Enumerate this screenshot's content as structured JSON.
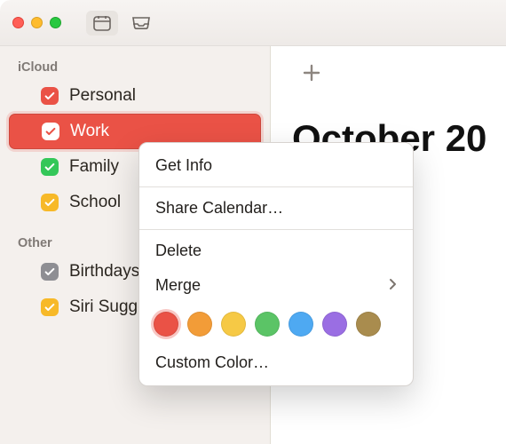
{
  "sidebar": {
    "sections": [
      {
        "title": "iCloud",
        "items": [
          {
            "label": "Personal",
            "color": "#ea5246",
            "selected": false
          },
          {
            "label": "Work",
            "color": "#ea5246",
            "selected": true
          },
          {
            "label": "Family",
            "color": "#34c759",
            "selected": false
          },
          {
            "label": "School",
            "color": "#f7b928",
            "selected": false
          }
        ]
      },
      {
        "title": "Other",
        "items": [
          {
            "label": "Birthdays",
            "color": "#8e8e93",
            "selected": false
          },
          {
            "label": "Siri Suggestions",
            "color": "#f7b928",
            "selected": false
          }
        ]
      }
    ]
  },
  "main": {
    "month_title": "October 20"
  },
  "context_menu": {
    "get_info": "Get Info",
    "share": "Share Calendar…",
    "delete": "Delete",
    "merge": "Merge",
    "custom_color": "Custom Color…",
    "swatches": [
      {
        "color": "#ea5246",
        "selected": true
      },
      {
        "color": "#f29c38",
        "selected": false
      },
      {
        "color": "#f6c945",
        "selected": false
      },
      {
        "color": "#5bc466",
        "selected": false
      },
      {
        "color": "#4ea9f2",
        "selected": false
      },
      {
        "color": "#9a6ee3",
        "selected": false
      },
      {
        "color": "#a98c4e",
        "selected": false
      }
    ]
  }
}
